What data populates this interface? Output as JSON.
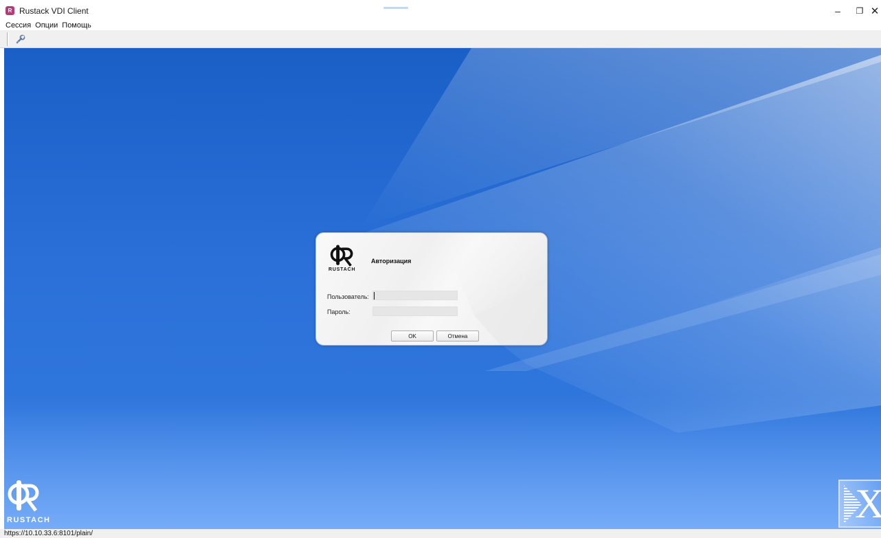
{
  "window": {
    "title": "Rustack VDI Client",
    "minimize": "–",
    "restore": "❐",
    "close": "✕"
  },
  "menu": {
    "items": [
      "Сессия",
      "Опции",
      "Помощь"
    ]
  },
  "toolbar": {
    "settings_icon": "wrench-icon"
  },
  "dialog": {
    "logo_text": "RUSTACH",
    "title": "Авторизация",
    "user_label": "Пользователь:",
    "user_value": "",
    "password_label": "Пароль:",
    "password_value": "",
    "ok_label": "OK",
    "cancel_label": "Отмена"
  },
  "desktop": {
    "logo_text": "RUSTACH",
    "x_logo_letter": "X"
  },
  "status": {
    "url": "https://10.10.33.6:8101/plain/"
  },
  "colors": {
    "desktop_blue": "#2a70d8",
    "brand_magenta": "#b43b79"
  }
}
